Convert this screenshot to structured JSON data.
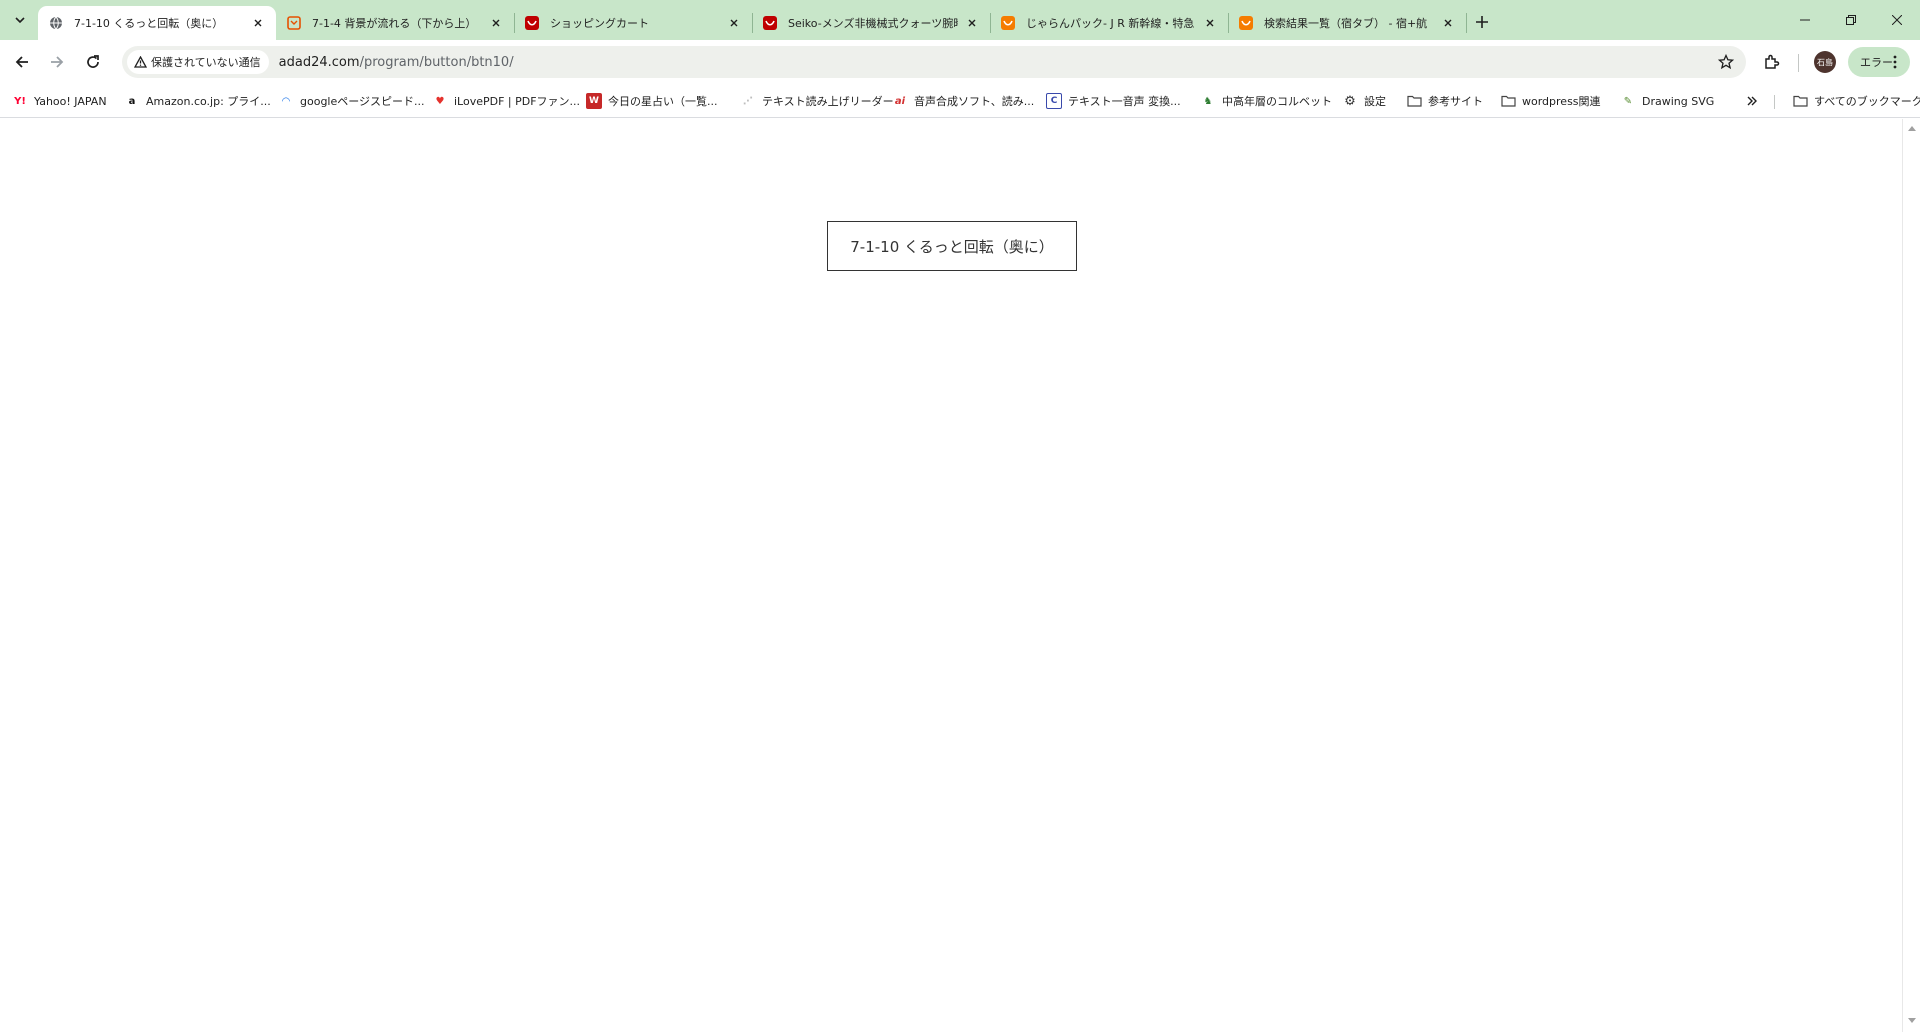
{
  "tabs": [
    {
      "title": "7-1-10 くるっと回転（奥に）",
      "icon": "globe-icon",
      "active": true
    },
    {
      "title": "7-1-4 背景が流れる（下から上）",
      "icon": "code-favicon-icon",
      "active": false
    },
    {
      "title": "ショッピングカート",
      "icon": "rakuten-favicon-icon",
      "active": false
    },
    {
      "title": "Seiko-メンズ非機械式クォーツ腕時",
      "icon": "rakuten-favicon-icon",
      "active": false
    },
    {
      "title": "じゃらんパック- J R 新幹線・特急",
      "icon": "jalan-favicon-icon",
      "active": false
    },
    {
      "title": "検索結果一覧（宿タブ） - 宿+航",
      "icon": "jalan-favicon-icon",
      "active": false
    }
  ],
  "toolbar": {
    "security_label": "保護されていない通信",
    "url_host": "adad24.com",
    "url_path": "/program/button/btn10/",
    "avatar_text": "石島",
    "error_label": "エラー"
  },
  "bookmarks": [
    {
      "label": "Yahoo! JAPAN",
      "icon": "yahoo-icon",
      "glyph": "Y!",
      "color": "#ff0033"
    },
    {
      "label": "Amazon.co.jp: プライ...",
      "icon": "amazon-icon",
      "glyph": "a",
      "color": "#111111"
    },
    {
      "label": "googleページスピード...",
      "icon": "pagespeed-icon",
      "glyph": "◠",
      "color": "#1a73e8"
    },
    {
      "label": "iLovePDF | PDFファン...",
      "icon": "ilovepdf-icon",
      "glyph": "♥",
      "color": "#e5322d"
    },
    {
      "label": "今日の星占い（一覧...",
      "icon": "horoscope-icon",
      "glyph": "W",
      "color": "#c62828"
    },
    {
      "label": "テキスト読み上げリーダー",
      "icon": "tts-icon",
      "glyph": "⋰",
      "color": "#bdbdbd"
    },
    {
      "label": "音声合成ソフト、読み...",
      "icon": "voice-icon",
      "glyph": "ai",
      "color": "#d32f2f"
    },
    {
      "label": "テキスト一音声 変換...",
      "icon": "convert-icon",
      "glyph": "C",
      "color": "#3949ab"
    },
    {
      "label": "中高年層のコルベット",
      "icon": "corvette-icon",
      "glyph": "♞",
      "color": "#2e7d32"
    },
    {
      "label": "設定",
      "icon": "gear-icon",
      "glyph": "⚙",
      "color": "#333333"
    },
    {
      "label": "参考サイト",
      "icon": "folder-icon",
      "glyph": "",
      "color": "#444444"
    },
    {
      "label": "wordpress関連",
      "icon": "folder-icon",
      "glyph": "",
      "color": "#444444"
    },
    {
      "label": "Drawing SVG",
      "icon": "svg-leaf-icon",
      "glyph": "✎",
      "color": "#558b2f"
    }
  ],
  "all_bookmarks_label": "すべてのブックマーク",
  "page": {
    "button_label": "7-1-10 くるっと回転（奥に）"
  }
}
